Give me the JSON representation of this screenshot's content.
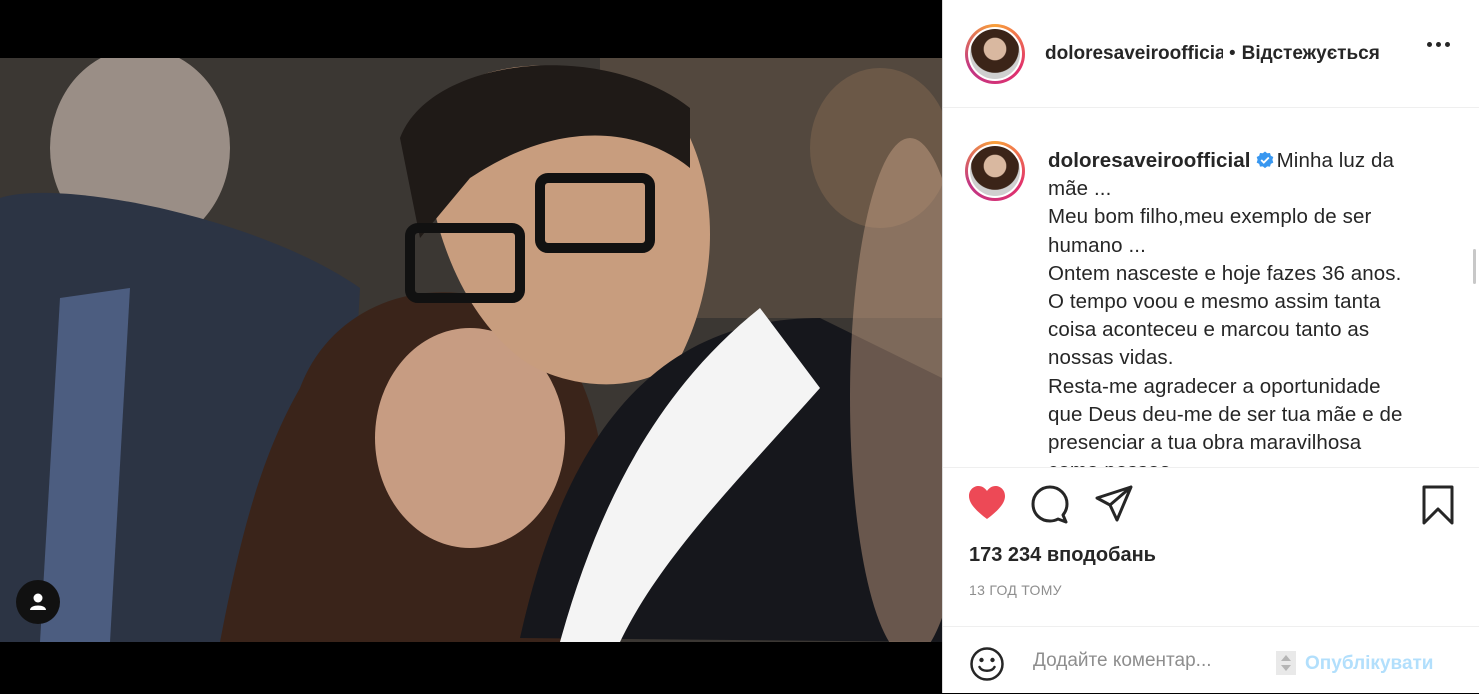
{
  "post": {
    "username_short": "doloresaveiroofficial",
    "separator": "•",
    "follow_status": "Відстежується",
    "caption": {
      "username": "doloresaveiroofficial",
      "text": "Minha luz da\nmãe ...\nMeu bom filho,meu exemplo de ser\nhumano ...\nOntem nasceste e hoje fazes 36 anos.\nO tempo voou e mesmo assim tanta\ncoisa aconteceu e marcou tanto as\nnossas vidas.\nResta-me agradecer a oportunidade\nque Deus deu-me de ser tua mãe e de\npresenciar a tua obra maravilhosa\ncomo pessoa"
    },
    "likes": "173 234 вподобань",
    "timestamp": "13 ГОД ТОМУ"
  },
  "comment": {
    "placeholder": "Додайте коментар...",
    "post_label": "Опублікувати"
  },
  "icons": {
    "like": "heart-filled-icon",
    "comment": "comment-icon",
    "share": "share-icon",
    "save": "bookmark-icon",
    "more": "more-options-icon",
    "emoji": "emoji-icon",
    "tag": "user-tag-icon",
    "verified": "verified-badge-icon"
  },
  "colors": {
    "like": "#ed4956",
    "verified": "#3897f0",
    "post_button": "#b2dffc"
  }
}
